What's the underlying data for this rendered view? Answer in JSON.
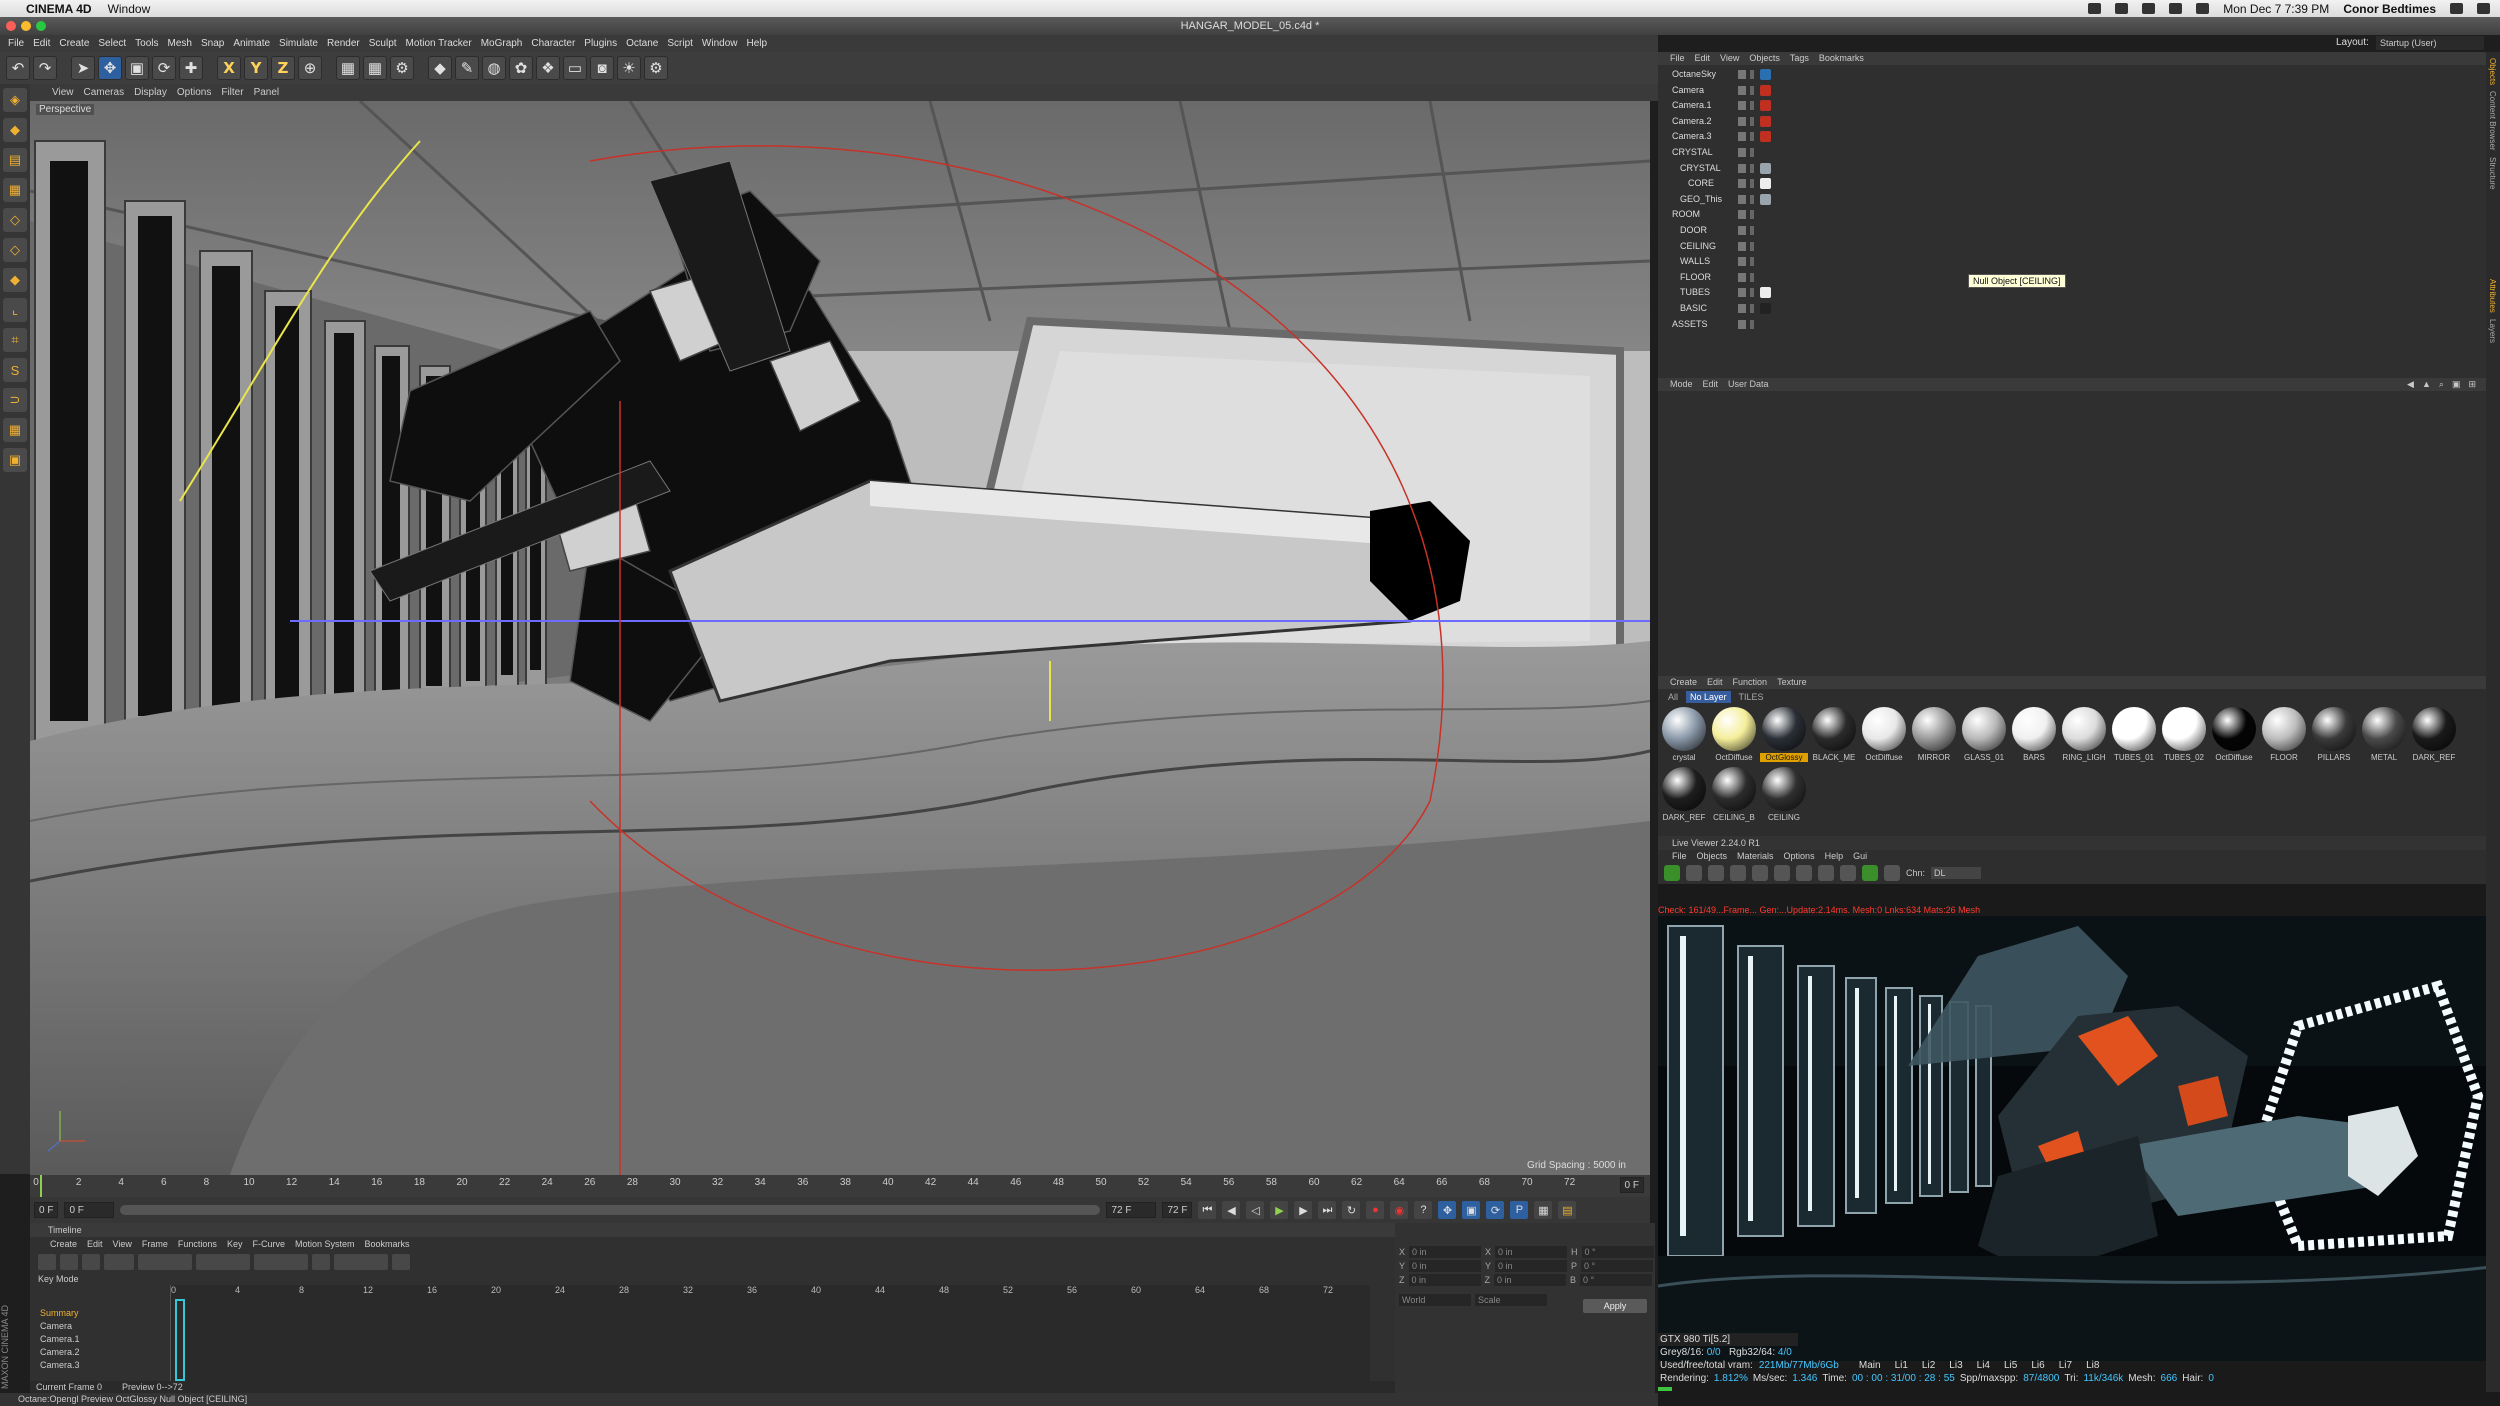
{
  "mac_menubar": {
    "app_name": "CINEMA 4D",
    "menus": [
      "Window"
    ],
    "datetime": "Mon Dec 7  7:39 PM",
    "user": "Conor Bedtimes"
  },
  "window": {
    "title": "HANGAR_MODEL_05.c4d *"
  },
  "main_menu": [
    "File",
    "Edit",
    "Create",
    "Select",
    "Tools",
    "Mesh",
    "Snap",
    "Animate",
    "Simulate",
    "Render",
    "Sculpt",
    "Motion Tracker",
    "MoGraph",
    "Character",
    "Plugins",
    "Octane",
    "Script",
    "Window",
    "Help"
  ],
  "toolbar": {
    "axis_x": "X",
    "axis_y": "Y",
    "axis_z": "Z"
  },
  "viewport": {
    "menu": [
      "View",
      "Cameras",
      "Display",
      "Options",
      "Filter",
      "Panel"
    ],
    "label": "Perspective",
    "grid_spacing": "Grid Spacing : 5000 in"
  },
  "timeline_ruler": {
    "ticks": [
      "0",
      "2",
      "4",
      "6",
      "8",
      "10",
      "12",
      "14",
      "16",
      "18",
      "20",
      "22",
      "24",
      "26",
      "28",
      "30",
      "32",
      "34",
      "36",
      "38",
      "40",
      "42",
      "44",
      "46",
      "48",
      "50",
      "52",
      "54",
      "56",
      "58",
      "60",
      "62",
      "64",
      "66",
      "68",
      "70",
      "72"
    ],
    "frame_readout": "0 F"
  },
  "frame_controls": {
    "start": "0 F",
    "start_field": "0 F",
    "end_field": "72 F",
    "end": "72 F"
  },
  "timeline_panel": {
    "title": "Timeline",
    "menu": [
      "Create",
      "Edit",
      "View",
      "Frame",
      "Functions",
      "Key",
      "F-Curve",
      "Motion System",
      "Bookmarks"
    ],
    "mode": "Key Mode",
    "rows": [
      "Summary",
      "Camera",
      "Camera.1",
      "Camera.2",
      "Camera.3"
    ],
    "ruler": [
      "0",
      "4",
      "8",
      "12",
      "16",
      "20",
      "24",
      "28",
      "32",
      "36",
      "40",
      "44",
      "48",
      "52",
      "56",
      "60",
      "64",
      "68",
      "72"
    ],
    "footer_current": "Current Frame  0",
    "footer_preview": "Preview  0-->72"
  },
  "coordinates": {
    "rows": [
      {
        "a": "X",
        "av": "0 in",
        "b": "X",
        "bv": "0 in",
        "c": "H",
        "cv": "0 °"
      },
      {
        "a": "Y",
        "av": "0 in",
        "b": "Y",
        "bv": "0 in",
        "c": "P",
        "cv": "0 °"
      },
      {
        "a": "Z",
        "av": "0 in",
        "b": "Z",
        "bv": "0 in",
        "c": "B",
        "cv": "0 °"
      }
    ],
    "space": "World",
    "mode": "Scale",
    "apply": "Apply"
  },
  "status_bar": "Octane:Opengl Preview OctGlossy            Null Object [CEILING]",
  "maxon": "MAXON CINEMA 4D",
  "layout": {
    "label": "Layout:",
    "value": "Startup (User)"
  },
  "object_manager": {
    "menu": [
      "File",
      "Edit",
      "View",
      "Objects",
      "Tags",
      "Bookmarks"
    ],
    "objects": [
      {
        "name": "OctaneSky",
        "indent": 0,
        "tag": "#2a6fb0"
      },
      {
        "name": "Camera",
        "indent": 0,
        "tag": "#c03020"
      },
      {
        "name": "Camera.1",
        "indent": 0,
        "tag": "#c03020"
      },
      {
        "name": "Camera.2",
        "indent": 0,
        "tag": "#c03020"
      },
      {
        "name": "Camera.3",
        "indent": 0,
        "tag": "#c03020"
      },
      {
        "name": "CRYSTAL",
        "indent": 0,
        "tag": ""
      },
      {
        "name": "CRYSTAL",
        "indent": 1,
        "tag": "#9aa4ad"
      },
      {
        "name": "CORE",
        "indent": 2,
        "tag": "#eeeeee"
      },
      {
        "name": "GEO_This",
        "indent": 1,
        "tag": "#9aa4ad"
      },
      {
        "name": "ROOM",
        "indent": 0,
        "tag": ""
      },
      {
        "name": "DOOR",
        "indent": 1,
        "tag": ""
      },
      {
        "name": "CEILING",
        "indent": 1,
        "tag": ""
      },
      {
        "name": "WALLS",
        "indent": 1,
        "tag": ""
      },
      {
        "name": "FLOOR",
        "indent": 1,
        "tag": ""
      },
      {
        "name": "TUBES",
        "indent": 1,
        "tag": "#eeeeee"
      },
      {
        "name": "BASIC",
        "indent": 1,
        "tag": "#222222"
      },
      {
        "name": "ASSETS",
        "indent": 0,
        "tag": ""
      }
    ],
    "tooltip": "Null Object [CEILING]"
  },
  "attribute_manager": {
    "menu": [
      "Mode",
      "Edit",
      "User Data"
    ]
  },
  "material_manager": {
    "menu": [
      "Create",
      "Edit",
      "Function",
      "Texture"
    ],
    "tabs": [
      "All",
      "No Layer",
      "TILES"
    ],
    "materials": [
      {
        "name": "crystal",
        "color": "#8a98a8"
      },
      {
        "name": "OctDiffuse",
        "color": "#f4ee9a"
      },
      {
        "name": "OctGlossy",
        "color": "#2a2f36",
        "selected": true
      },
      {
        "name": "BLACK_ME",
        "color": "#2b2b2b"
      },
      {
        "name": "OctDiffuse",
        "color": "#e8e8e8"
      },
      {
        "name": "MIRROR",
        "color": "#9a9a9a"
      },
      {
        "name": "GLASS_01",
        "color": "#b8b8b8"
      },
      {
        "name": "BARS",
        "color": "#f0f0f0"
      },
      {
        "name": "RING_LIGH",
        "color": "#dcdcdc"
      },
      {
        "name": "TUBES_01",
        "color": "#ffffff"
      },
      {
        "name": "TUBES_02",
        "color": "#ffffff"
      },
      {
        "name": "OctDiffuse",
        "color": "#050505"
      },
      {
        "name": "FLOOR",
        "color": "#bdbdbd"
      },
      {
        "name": "PILLARS",
        "color": "#3a3a3a"
      },
      {
        "name": "METAL",
        "color": "#4a4a4a"
      },
      {
        "name": "DARK_REF",
        "color": "#1a1a1a"
      },
      {
        "name": "DARK_REF",
        "color": "#1e1e1e"
      },
      {
        "name": "CEILING_B",
        "color": "#2c2c2c"
      },
      {
        "name": "CEILING",
        "color": "#303030"
      }
    ]
  },
  "live_viewer": {
    "title": "Live Viewer 2.24.0 R1",
    "menu": [
      "File",
      "Objects",
      "Materials",
      "Options",
      "Help",
      "Gui"
    ],
    "channel_label": "Chn:",
    "channel_value": "DL",
    "status_line": "Check: 161/49...Frame... Gen:...Update:2.14ms. Mesh:0 Lnks:634 Mats:26 Mesh",
    "gpu": "GTX 980 Ti[5.2]",
    "grey": "Grey8/16:",
    "grey_v": "0/0",
    "rgb": "Rgb32/64:",
    "rgb_v": "4/0",
    "vram": "Used/free/total vram:",
    "vram_v": "221Mb/77Mb/6Gb",
    "tabs": [
      "Main",
      "Li1",
      "Li2",
      "Li3",
      "Li4",
      "Li5",
      "Li6",
      "Li7",
      "Li8"
    ],
    "rendering_label": "Rendering:",
    "rendering_v": "1.812%",
    "mssec_label": "Ms/sec:",
    "mssec_v": "1.346",
    "time_label": "Time:",
    "time_v": "00 : 00 : 31/00 : 28 : 55",
    "spp_label": "Spp/maxspp:",
    "spp_v": "87/4800",
    "tri_label": "Tri:",
    "tri_v": "11k/346k",
    "mesh_label": "Mesh:",
    "mesh_v": "666",
    "hair_label": "Hair:",
    "hair_v": "0"
  },
  "right_strip": [
    "Objects",
    "Content Browser",
    "Structure",
    "Attributes",
    "Layers"
  ]
}
